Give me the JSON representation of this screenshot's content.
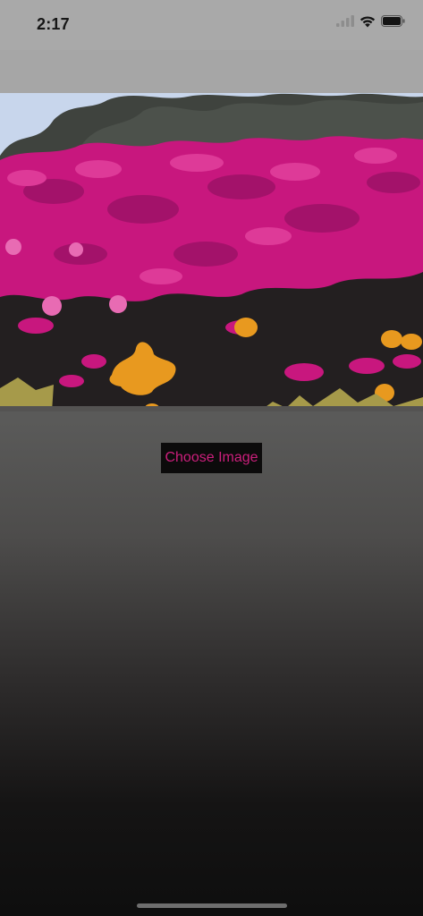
{
  "status_bar": {
    "time": "2:17",
    "icons": [
      "cellular-signal-icon",
      "wifi-icon",
      "battery-icon"
    ]
  },
  "image_view": {
    "description_icon": "flower-garden-photo"
  },
  "actions": {
    "choose_image_label": "Choose Image"
  },
  "colors": {
    "accent_text": "#cc1f7c",
    "button_background": "#0c0b0b",
    "status_bar_background": "#a9a9a9"
  }
}
